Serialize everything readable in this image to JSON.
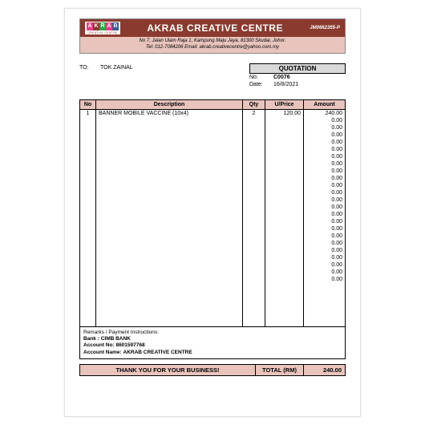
{
  "header": {
    "logo_letters": [
      "A",
      "K",
      "R",
      "A",
      "B"
    ],
    "logo_sub": "CREATIVE CENTRE",
    "company_name": "AKRAB CREATIVE CENTRE",
    "reg_no": "JM0662355-P",
    "address": "No 7, Jalan Ulam Raja 1, Kampung Maju Jaya, 81300 Skudai, Johor.",
    "contact": "Tel: 012-7084206  Email: akrab.creativecentre@yahoo.com.my"
  },
  "to": {
    "label": "TO:",
    "name": "TOK ZAINAL"
  },
  "quotation": {
    "title": "QUOTATION",
    "no_label": "No:",
    "no": "C0076",
    "date_label": "Date:",
    "date": "16/8/2021"
  },
  "columns": {
    "no": "No",
    "desc": "Description",
    "qty": "Qty",
    "price": "U/Price",
    "amount": "Amount"
  },
  "rows": [
    {
      "no": "1",
      "desc": "BANNER MOBILE VACCINE (10x4)",
      "qty": "2",
      "price": "120.00",
      "amount": "240.00"
    },
    {
      "no": "",
      "desc": "",
      "qty": "",
      "price": "",
      "amount": "0.00"
    },
    {
      "no": "",
      "desc": "",
      "qty": "",
      "price": "",
      "amount": "0.00"
    },
    {
      "no": "",
      "desc": "",
      "qty": "",
      "price": "",
      "amount": "0.00"
    },
    {
      "no": "",
      "desc": "",
      "qty": "",
      "price": "",
      "amount": "0.00"
    },
    {
      "no": "",
      "desc": "",
      "qty": "",
      "price": "",
      "amount": "0.00"
    },
    {
      "no": "",
      "desc": "",
      "qty": "",
      "price": "",
      "amount": "0.00"
    },
    {
      "no": "",
      "desc": "",
      "qty": "",
      "price": "",
      "amount": "0.00"
    },
    {
      "no": "",
      "desc": "",
      "qty": "",
      "price": "",
      "amount": "0.00"
    },
    {
      "no": "",
      "desc": "",
      "qty": "",
      "price": "",
      "amount": "0.00"
    },
    {
      "no": "",
      "desc": "",
      "qty": "",
      "price": "",
      "amount": "0.00"
    },
    {
      "no": "",
      "desc": "",
      "qty": "",
      "price": "",
      "amount": "0.00"
    },
    {
      "no": "",
      "desc": "",
      "qty": "",
      "price": "",
      "amount": "0.00"
    },
    {
      "no": "",
      "desc": "",
      "qty": "",
      "price": "",
      "amount": "0.00"
    },
    {
      "no": "",
      "desc": "",
      "qty": "",
      "price": "",
      "amount": "0.00"
    },
    {
      "no": "",
      "desc": "",
      "qty": "",
      "price": "",
      "amount": "0.00"
    },
    {
      "no": "",
      "desc": "",
      "qty": "",
      "price": "",
      "amount": "0.00"
    },
    {
      "no": "",
      "desc": "",
      "qty": "",
      "price": "",
      "amount": "0.00"
    },
    {
      "no": "",
      "desc": "",
      "qty": "",
      "price": "",
      "amount": "0.00"
    },
    {
      "no": "",
      "desc": "",
      "qty": "",
      "price": "",
      "amount": "0.00"
    },
    {
      "no": "",
      "desc": "",
      "qty": "",
      "price": "",
      "amount": "0.00"
    },
    {
      "no": "",
      "desc": "",
      "qty": "",
      "price": "",
      "amount": "0.00"
    },
    {
      "no": "",
      "desc": "",
      "qty": "",
      "price": "",
      "amount": "0.00"
    },
    {
      "no": "",
      "desc": "",
      "qty": "",
      "price": "",
      "amount": "0.00"
    }
  ],
  "remarks": {
    "title": "Remarks / Payment Instructions:",
    "bank_label": "Bank :",
    "bank": "CIMB BANK",
    "acct_no_label": "Account No:",
    "acct_no": "8601597768",
    "acct_name_label": "Account Name:",
    "acct_name": "AKRAB CREATIVE CENTRE"
  },
  "footer": {
    "thanks": "THANK YOU FOR YOUR BUSINESS!",
    "total_label": "TOTAL (RM)",
    "total": "240.00"
  }
}
